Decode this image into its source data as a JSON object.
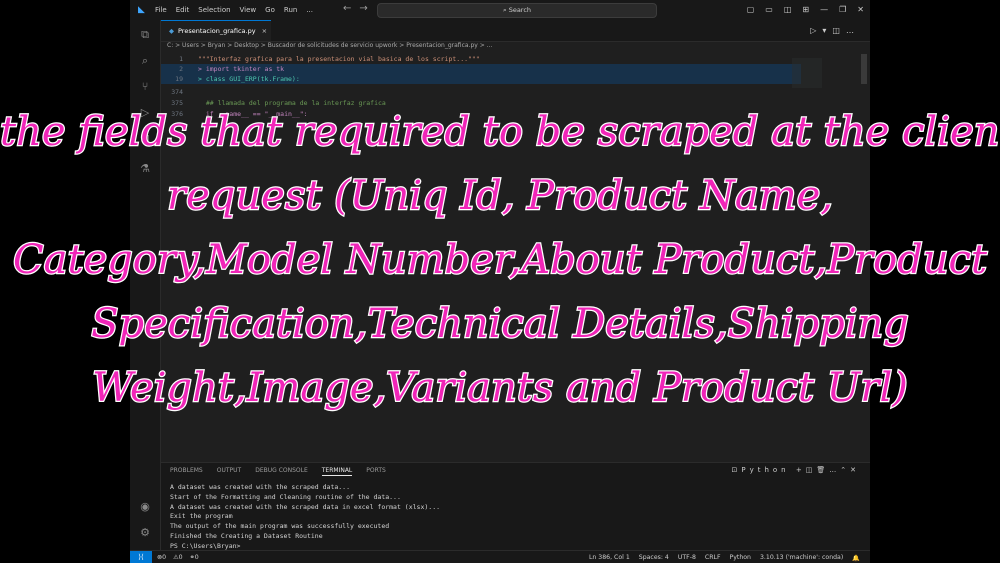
{
  "titlebar": {
    "menu": [
      "File",
      "Edit",
      "Selection",
      "View",
      "Go",
      "Run",
      "..."
    ],
    "search": "Search"
  },
  "tab": {
    "file": "Presentacion_grafica.py"
  },
  "breadcrumb": "C: > Users > Bryan > Desktop > Buscador de solicitudes de servicio upwork > Presentacion_grafica.py > ...",
  "editor": {
    "lines": [
      {
        "no": "1",
        "code": "\"\"\"Interfaz grafica para la presentacion vial basica de los script...\"\"\""
      },
      {
        "no": "2",
        "code": "> import tkinter as tk"
      },
      {
        "no": "19",
        "code": "> class GUI_ERP(tk.Frame):"
      },
      {
        "no": "374",
        "code": ""
      },
      {
        "no": "375",
        "code": "  ## llamada del programa de la interfaz grafica"
      },
      {
        "no": "376",
        "code": "  if __name__ == \"__main__\":"
      }
    ]
  },
  "panel": {
    "tabs": [
      "PROBLEMS",
      "OUTPUT",
      "DEBUG CONSOLE",
      "TERMINAL",
      "PORTS"
    ],
    "active_tab": "TERMINAL",
    "shell": "Python",
    "terminal_lines": [
      "A dataset was created with the scraped data...",
      "Start of the Formatting and Cleaning routine of the data...",
      "A dataset was created with the scraped data in excel format (xlsx)...",
      "Exit the program",
      "The output of the main program was successfully executed",
      "Finished the Creating a Dataset Routine",
      "PS C:\\Users\\Bryan>"
    ]
  },
  "status": {
    "errors": "⊗0",
    "warnings": "⚠0",
    "ports": "⚭0",
    "position": "Ln 386, Col 1",
    "spaces": "Spaces: 4",
    "encoding": "UTF-8",
    "eol": "CRLF",
    "language": "Python",
    "interpreter": "3.10.13 ('machine': conda)"
  },
  "caption": {
    "lines": [
      "the fields that required to be scraped at the clients",
      "request (Uniq Id, Product Name,",
      "Category,Model Number,About Product,Product",
      "Specification,Technical Details,Shipping",
      "Weight,Image,Variants and Product Url)"
    ],
    "color": "#f025b8"
  }
}
